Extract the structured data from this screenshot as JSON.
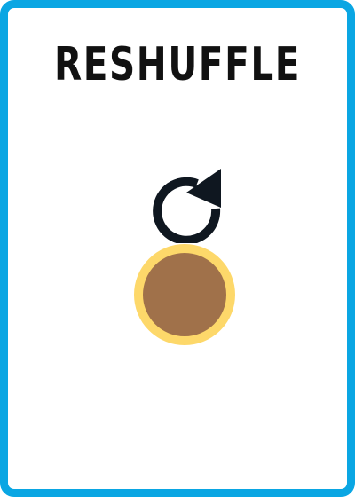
{
  "card": {
    "title": "RESHUFFLE",
    "border_color": "#0aa6e3",
    "icon": "reshuffle-arrow-icon",
    "token": {
      "name": "coin-token",
      "fill_color": "#a0714a",
      "ring_color": "#fdd86a"
    }
  }
}
